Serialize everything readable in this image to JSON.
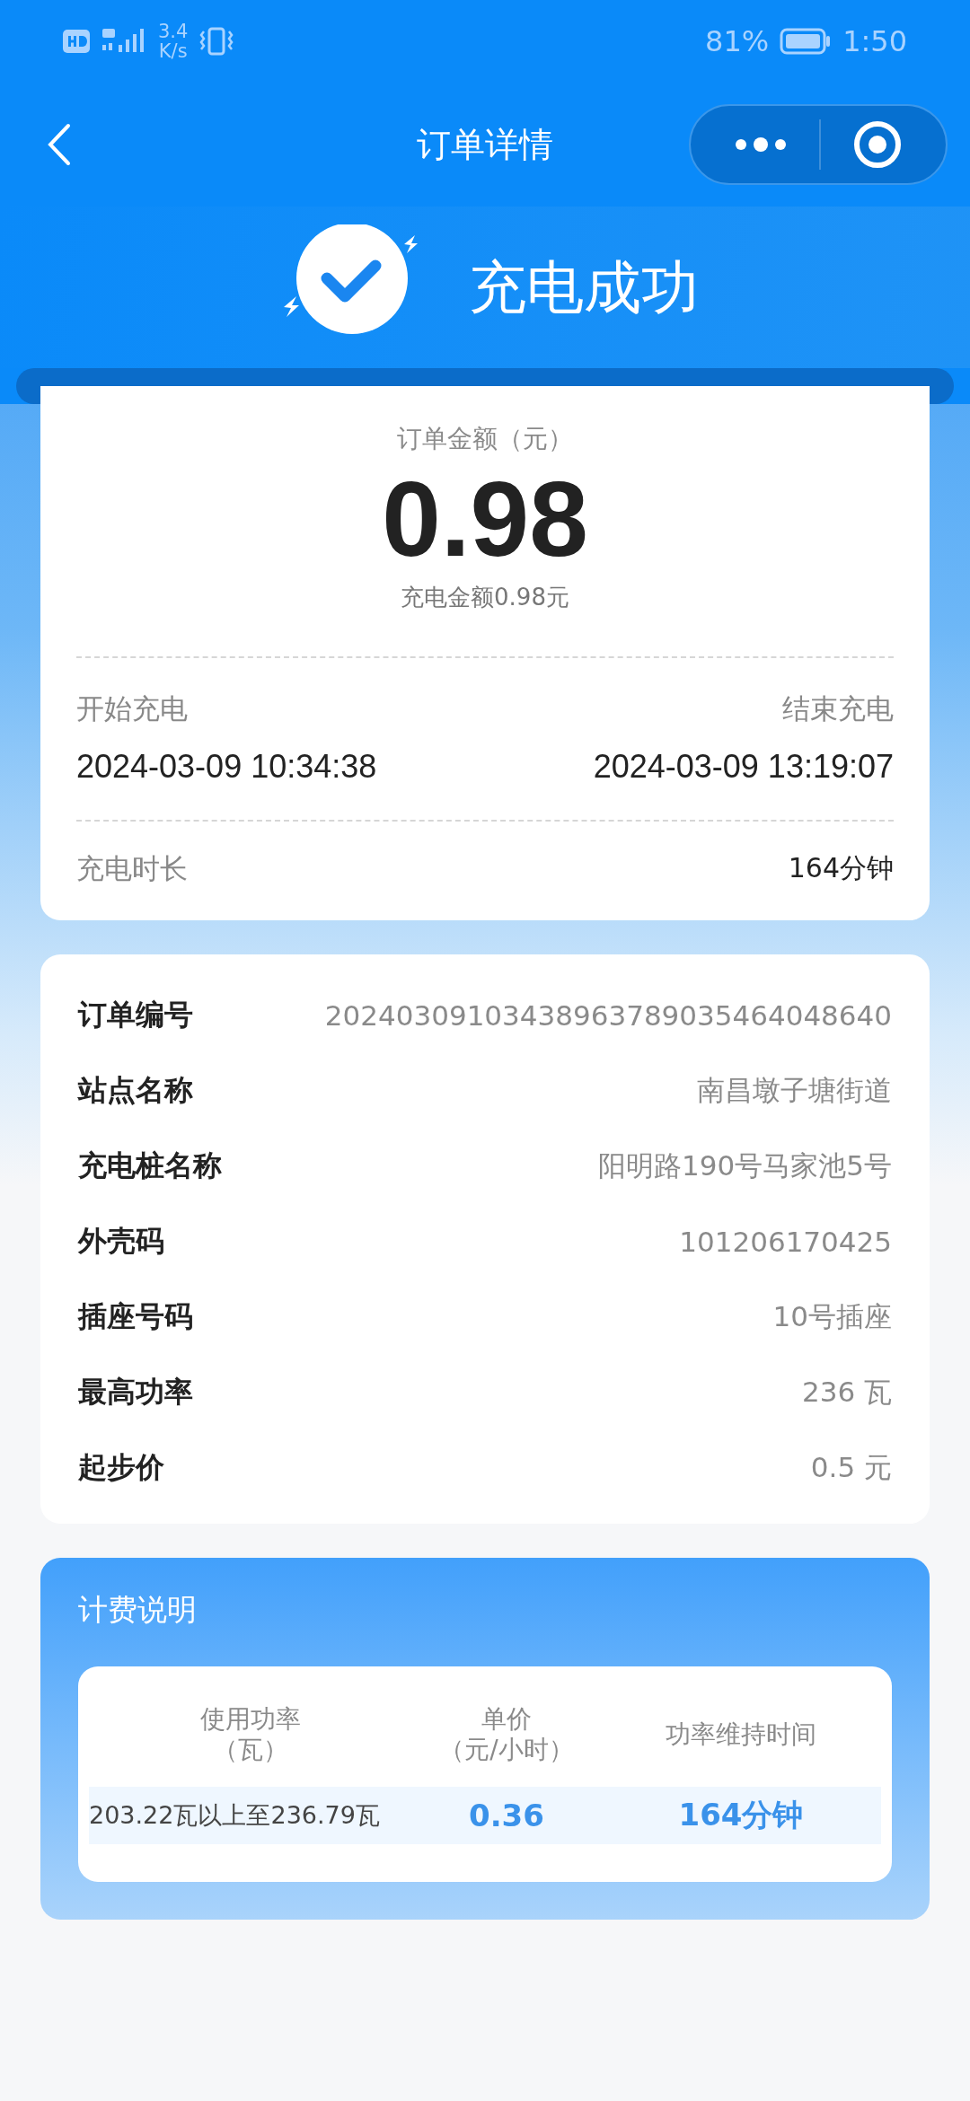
{
  "status_bar": {
    "speed": "3.4\nK/s",
    "battery": "81%",
    "time": "1:50"
  },
  "nav": {
    "title": "订单详情"
  },
  "banner": {
    "title": "充电成功"
  },
  "summary": {
    "amount_label": "订单金额（元）",
    "amount": "0.98",
    "amount_note": "充电金额0.98元",
    "start_label": "开始充电",
    "end_label": "结束充电",
    "start_time": "2024-03-09 10:34:38",
    "end_time": "2024-03-09 13:19:07",
    "duration_label": "充电时长",
    "duration": "164分钟"
  },
  "details": [
    {
      "label": "订单编号",
      "value": "20240309103438963789035464048640"
    },
    {
      "label": "站点名称",
      "value": "南昌墩子塘街道"
    },
    {
      "label": "充电桩名称",
      "value": "阳明路190号马家池5号"
    },
    {
      "label": "外壳码",
      "value": "101206170425"
    },
    {
      "label": "插座号码",
      "value": "10号插座"
    },
    {
      "label": "最高功率",
      "value": "236 瓦"
    },
    {
      "label": "起步价",
      "value": "0.5 元"
    }
  ],
  "billing": {
    "title": "计费说明",
    "columns": [
      {
        "label": "使用功率",
        "unit": "（瓦）"
      },
      {
        "label": "单价",
        "unit": "（元/小时）"
      },
      {
        "label": "功率维持时间"
      }
    ],
    "rows": [
      [
        "203.22瓦以上至236.79瓦",
        "0.36",
        "164分钟"
      ]
    ]
  }
}
